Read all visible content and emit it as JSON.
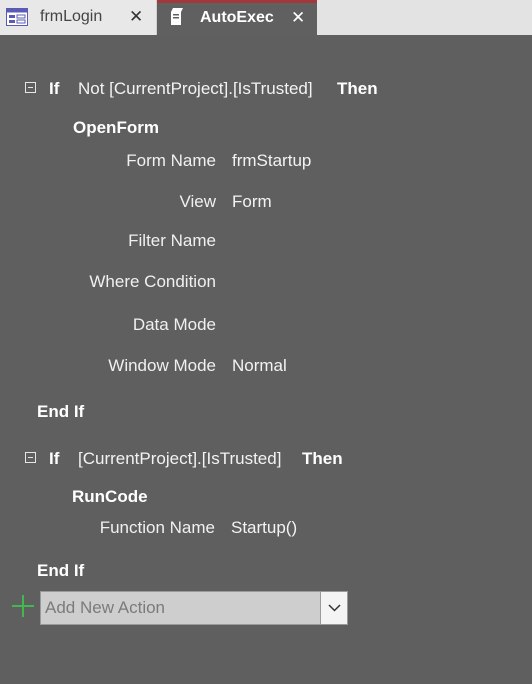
{
  "tabs": [
    {
      "label": "frmLogin",
      "icon": "form-icon",
      "active": false
    },
    {
      "label": "AutoExec",
      "icon": "macro-icon",
      "active": true
    }
  ],
  "block1": {
    "if_keyword": "If",
    "condition": "Not [CurrentProject].[IsTrusted]",
    "then_keyword": "Then",
    "action": "OpenForm",
    "args": [
      {
        "label": "Form Name",
        "value": "frmStartup"
      },
      {
        "label": "View",
        "value": "Form"
      },
      {
        "label": "Filter Name",
        "value": ""
      },
      {
        "label": "Where Condition",
        "value": ""
      },
      {
        "label": "Data Mode",
        "value": ""
      },
      {
        "label": "Window Mode",
        "value": "Normal"
      }
    ],
    "end_if": "End If"
  },
  "block2": {
    "if_keyword": "If",
    "condition": "[CurrentProject].[IsTrusted]",
    "then_keyword": "Then",
    "action": "RunCode",
    "args": [
      {
        "label": "Function Name",
        "value": "Startup()"
      }
    ],
    "end_if": "End If"
  },
  "add_action": {
    "placeholder": "Add New Action",
    "icon": "plus-icon"
  },
  "colors": {
    "background": "#5f5f5f",
    "active_tab_accent": "#a4373a",
    "plus_icon": "#3fb950"
  }
}
